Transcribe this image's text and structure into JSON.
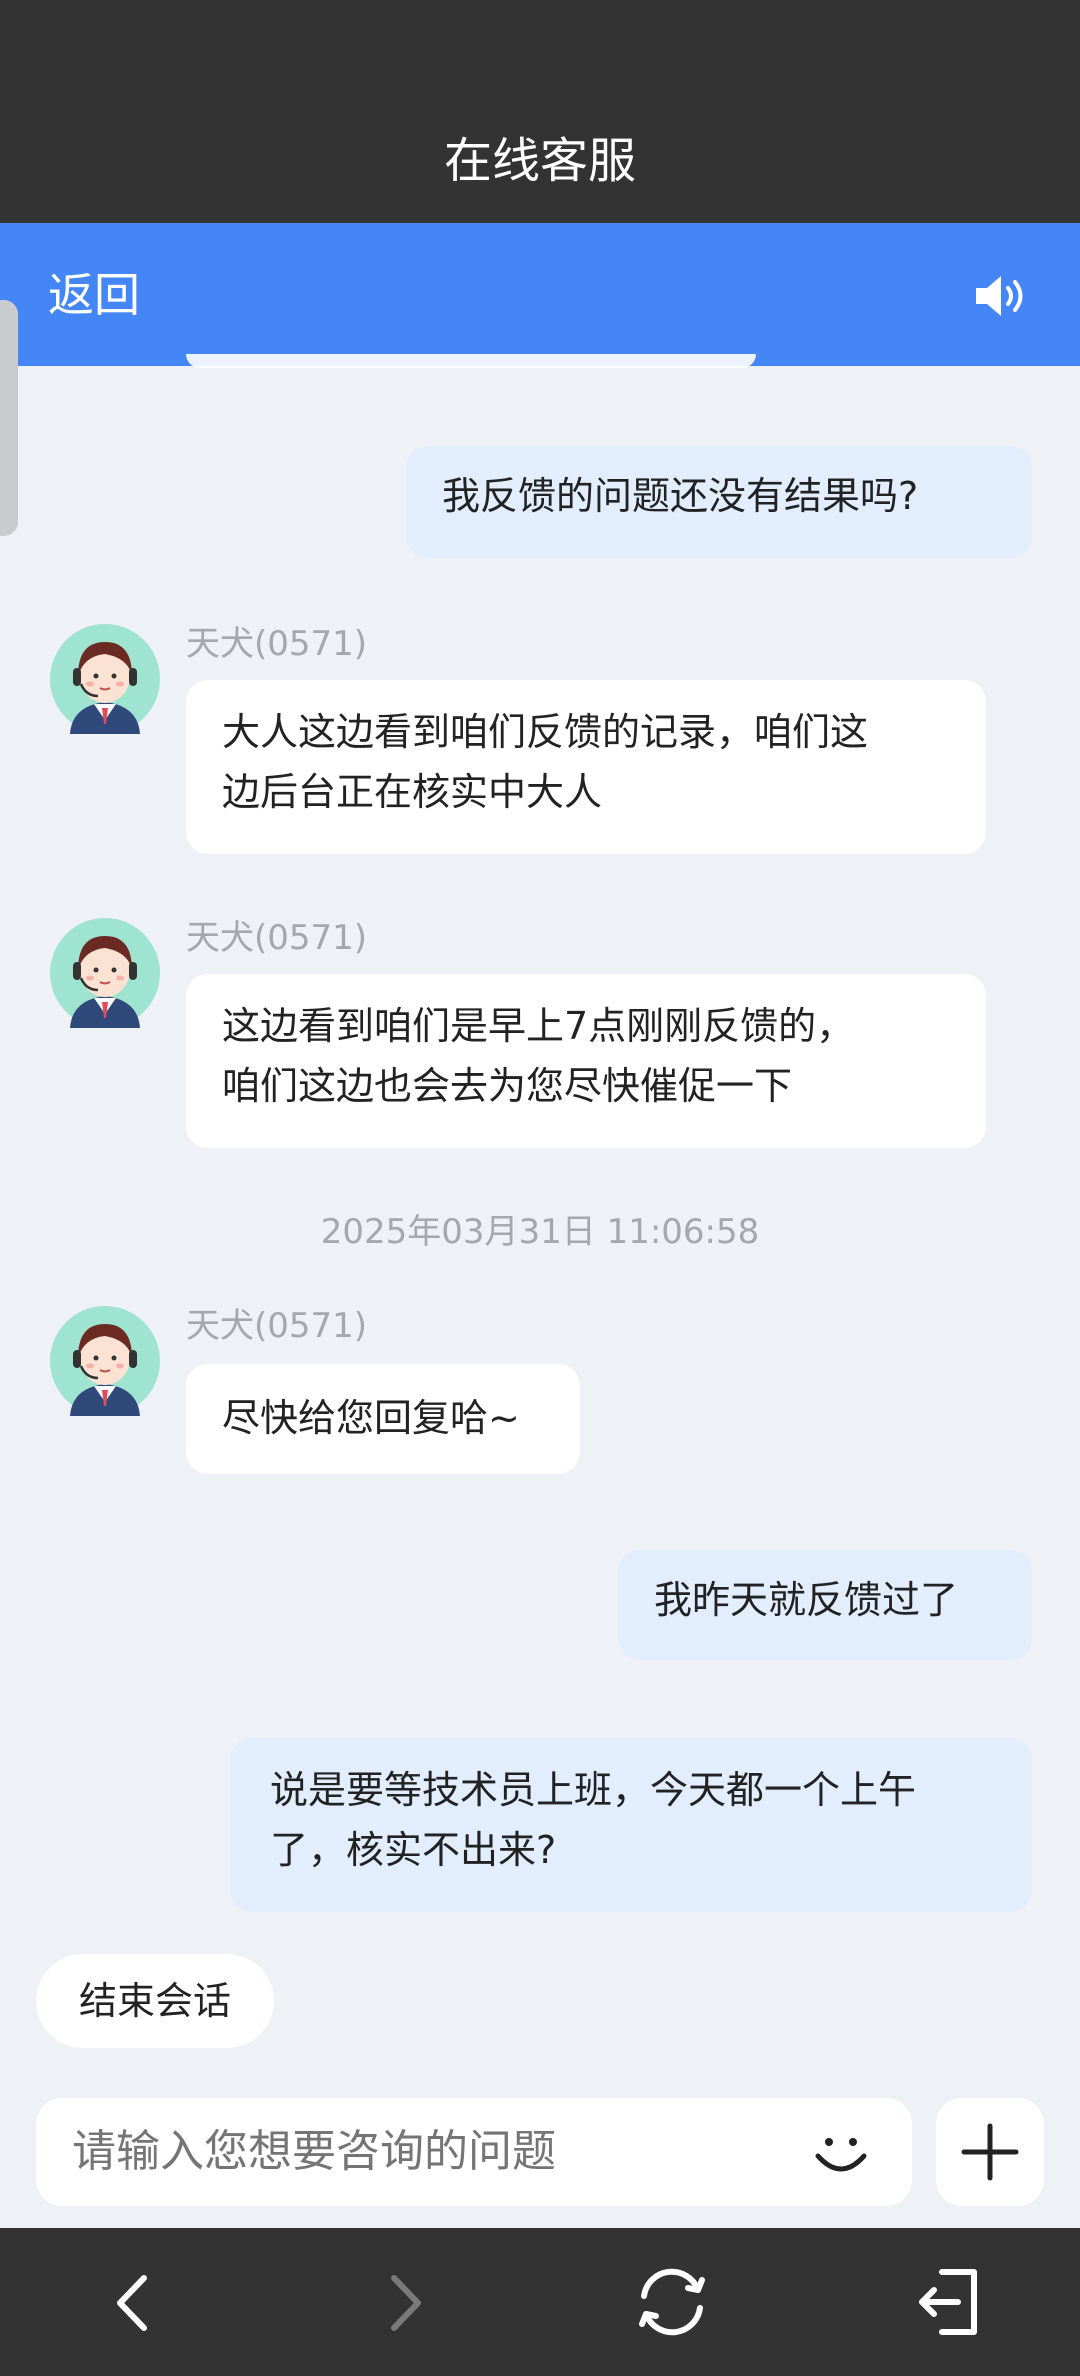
{
  "header": {
    "title": "在线客服"
  },
  "navbar": {
    "back_label": "返回",
    "sound_icon": "speaker-icon"
  },
  "messages": [
    {
      "side": "user",
      "text": "我反馈的问题还没有结果吗?"
    },
    {
      "side": "agent",
      "name": "天犬(0571)",
      "lines": [
        "大人这边看到咱们反馈的记录，咱们这",
        "边后台正在核实中大人"
      ]
    },
    {
      "side": "agent",
      "name": "天犬(0571)",
      "lines": [
        "这边看到咱们是早上7点刚刚反馈的，",
        "咱们这边也会去为您尽快催促一下"
      ]
    },
    {
      "side": "agent",
      "name": "天犬(0571)",
      "lines": [
        "尽快给您回复哈~"
      ]
    },
    {
      "side": "user",
      "text": "我昨天就反馈过了"
    },
    {
      "side": "user",
      "lines": [
        "说是要等技术员上班，今天都一个上午",
        "了，核实不出来?"
      ]
    }
  ],
  "timestamp": "2025年03月31日 11:06:58",
  "actions": {
    "end_session": "结束会话"
  },
  "composer": {
    "placeholder": "请输入您想要咨询的问题",
    "emoji_icon": "smile-icon",
    "add_icon": "plus-icon"
  },
  "bottom_nav": {
    "icons": [
      "back-arrow-icon",
      "forward-arrow-icon",
      "refresh-icon",
      "exit-icon"
    ]
  },
  "colors": {
    "primary": "#4486F5",
    "dark_bar": "#333333",
    "user_bubble": "#E2EDFE",
    "background": "#EEF1F5"
  }
}
